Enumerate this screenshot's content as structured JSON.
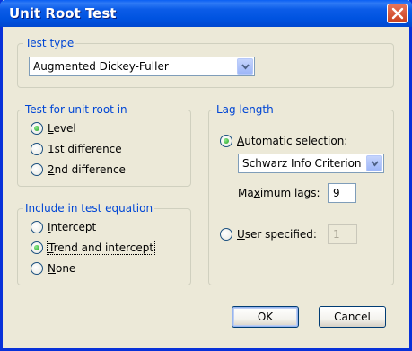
{
  "window": {
    "title": "Unit Root Test"
  },
  "test_type": {
    "legend": "Test type",
    "selected": "Augmented Dickey-Fuller"
  },
  "unit_root_in": {
    "legend": "Test for unit root in",
    "options": [
      {
        "label": "Level",
        "underline": "L",
        "rest": "evel",
        "checked": true
      },
      {
        "label": "1st difference",
        "underline": "1",
        "rest": "st difference",
        "checked": false
      },
      {
        "label": "2nd difference",
        "underline": "2",
        "rest": "nd difference",
        "checked": false
      }
    ]
  },
  "include_in_equation": {
    "legend": "Include in test equation",
    "options": [
      {
        "label": "Intercept",
        "underline": "I",
        "rest": "ntercept",
        "checked": false
      },
      {
        "label": "Trend and intercept",
        "underline": "T",
        "rest": "rend and intercept",
        "checked": true
      },
      {
        "label": "None",
        "underline": "N",
        "rest": "one",
        "checked": false
      }
    ]
  },
  "lag_length": {
    "legend": "Lag length",
    "automatic": {
      "underline": "A",
      "rest": "utomatic selection:",
      "checked": true
    },
    "criterion": "Schwarz Info Criterion",
    "max_lags_label_pre": "Ma",
    "max_lags_label_u": "x",
    "max_lags_label_post": "imum lags:",
    "max_lags_value": "9",
    "user_specified": {
      "underline": "U",
      "rest": "ser specified:",
      "checked": false
    },
    "user_value": "1"
  },
  "buttons": {
    "ok": "OK",
    "cancel": "Cancel"
  }
}
